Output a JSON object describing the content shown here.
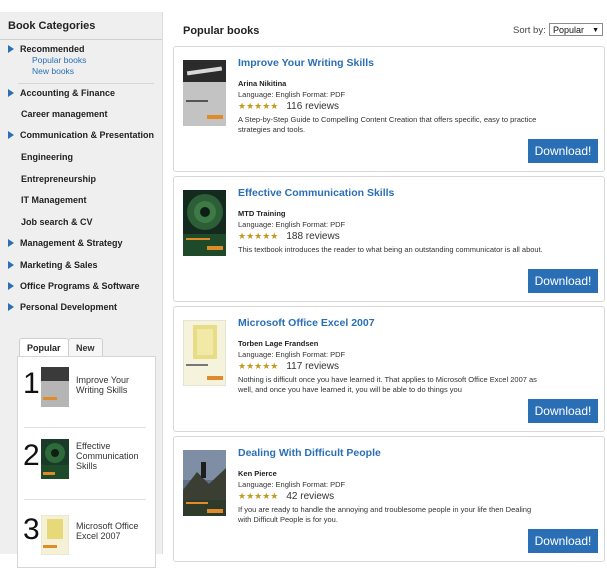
{
  "sidebar": {
    "title": "Book Categories",
    "recommended": {
      "label": "Recommended",
      "links": [
        "Popular books",
        "New books"
      ]
    },
    "categories": [
      {
        "label": "Accounting & Finance",
        "arrow": true
      },
      {
        "label": "Career management",
        "arrow": false
      },
      {
        "label": "Communication & Presentation",
        "arrow": true
      },
      {
        "label": "Engineering",
        "arrow": false
      },
      {
        "label": "Entrepreneurship",
        "arrow": false
      },
      {
        "label": "IT Management",
        "arrow": false
      },
      {
        "label": "Job search & CV",
        "arrow": false
      },
      {
        "label": "Management & Strategy",
        "arrow": true
      },
      {
        "label": "Marketing & Sales",
        "arrow": true
      },
      {
        "label": "Office Programs & Software",
        "arrow": true
      },
      {
        "label": "Personal Development",
        "arrow": true
      }
    ],
    "tabs": {
      "popular": "Popular",
      "new": "New"
    },
    "popular_list": [
      {
        "rank": "1",
        "title": "Improve Your Writing Skills"
      },
      {
        "rank": "2",
        "title": "Effective Communication Skills"
      },
      {
        "rank": "3",
        "title": "Microsoft Office Excel 2007"
      }
    ]
  },
  "main": {
    "title": "Popular books",
    "sort_label": "Sort by:",
    "sort_value": "Popular",
    "download_label": "Download!",
    "books": [
      {
        "title": "Improve Your Writing Skills",
        "author": "Arina Nikitina",
        "meta": "Language:  English  Format:  PDF",
        "reviews": "116 reviews",
        "description": "A Step-by-Step Guide to Compelling Content Creation that offers specific, easy to practice strategies and tools."
      },
      {
        "title": "Effective Communication Skills",
        "author": "MTD Training",
        "meta": "Language:  English  Format:  PDF",
        "reviews": "188 reviews",
        "description": "This textbook introduces the reader to what being an outstanding communicator is all about."
      },
      {
        "title": "Microsoft Office Excel 2007",
        "author": "Torben Lage Frandsen",
        "meta": "Language:  English  Format:  PDF",
        "reviews": "117 reviews",
        "description": "Nothing is difficult once you have learned it. That applies to Microsoft Office Excel 2007 as well, and once you have learned it, you will be able to do things you"
      },
      {
        "title": "Dealing With Difficult People",
        "author": "Ken Pierce",
        "meta": "Language:  English  Format:  PDF",
        "reviews": "42 reviews",
        "description": "If you are ready to handle the annoying and troublesome people in your life then Dealing with Difficult People is for you."
      }
    ]
  },
  "colors": {
    "accent": "#2a6fb5",
    "stars": "#c29a1f",
    "sidebar_bg": "#efefef"
  },
  "icons": {
    "category_arrow": "triangle-right-icon",
    "rating": "star-icon",
    "dropdown": "chevron-down-icon"
  }
}
